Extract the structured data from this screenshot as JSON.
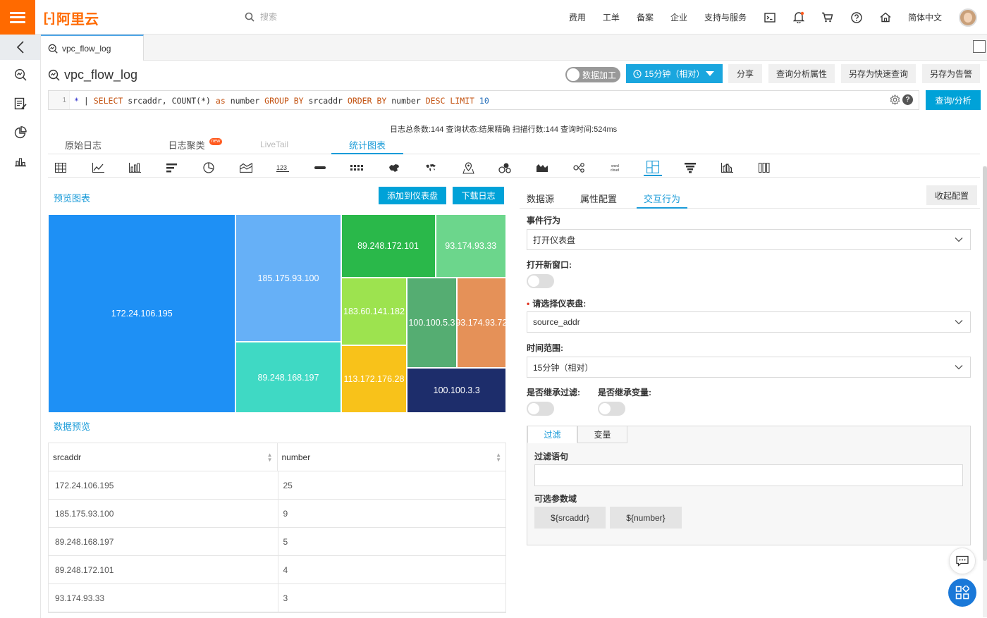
{
  "topbar": {
    "logo_text": "阿里云",
    "search_placeholder": "搜索",
    "nav": [
      "费用",
      "工单",
      "备案",
      "企业",
      "支持与服务"
    ],
    "language": "简体中文",
    "icons": [
      "terminal-icon",
      "bell-icon",
      "cart-icon",
      "help-icon",
      "home-icon"
    ]
  },
  "sidebar": {
    "icons": [
      "back-arrow-icon",
      "search-analysis-icon",
      "edit-list-icon",
      "pie-clock-icon",
      "dashboard-icon"
    ]
  },
  "tabstrip": {
    "active_tab": "vpc_flow_log"
  },
  "logstore": {
    "title": "vpc_flow_log",
    "data_process_label": "数据加工",
    "time_range_label": "15分钟（相对）",
    "buttons": [
      "分享",
      "查询分析属性",
      "另存为快速查询",
      "另存为告警"
    ]
  },
  "query": {
    "line_number": "1",
    "star": "*",
    "pipe": "|",
    "select_kw": "SELECT",
    "field1": "srcaddr,",
    "func": "COUNT(*)",
    "as_kw": "as",
    "alias": "number",
    "groupby_kw": "GROUP BY",
    "group_field": "srcaddr",
    "orderby_kw": "ORDER BY",
    "order_field": "number",
    "desc_kw": "DESC",
    "limit_kw": "LIMIT",
    "limit_val": "10",
    "submit_label": "查询/分析"
  },
  "stats": "日志总条数:144  查询状态:结果精确  扫描行数:144  查询时间:524ms",
  "main_tabs": {
    "raw": "原始日志",
    "cluster": "日志聚类",
    "cluster_badge": "new",
    "livetail": "LiveTail",
    "chart": "统计图表"
  },
  "chart_types": [
    "table",
    "line",
    "column",
    "bar",
    "pie",
    "area",
    "number",
    "progress",
    "flow",
    "map-china",
    "map-world",
    "map-amap",
    "sankey",
    "heatmap",
    "tree",
    "word-cloud",
    "treemap",
    "funnel",
    "histogram",
    "cross-table"
  ],
  "chart_types_active": "treemap",
  "preview": {
    "label": "预览图表",
    "add_to_dashboard": "添加到仪表盘",
    "download_log": "下载日志"
  },
  "chart_data": {
    "type": "treemap",
    "items": [
      {
        "label": "172.24.106.195",
        "value": 25,
        "color": "#1e90f5"
      },
      {
        "label": "185.175.93.100",
        "value": 9,
        "color": "#66b0f7"
      },
      {
        "label": "89.248.168.197",
        "value": 5,
        "color": "#3fd9c4"
      },
      {
        "label": "89.248.172.101",
        "value": 4,
        "color": "#2ab84a"
      },
      {
        "label": "93.174.93.33",
        "value": 3,
        "color": "#6cd68c"
      },
      {
        "label": "183.60.141.182",
        "value": 3,
        "color": "#9de34f"
      },
      {
        "label": "113.172.176.28",
        "value": 3,
        "color": "#f8c21a"
      },
      {
        "label": "100.100.5.3",
        "value": 3,
        "color": "#55ad72"
      },
      {
        "label": "93.174.93.72",
        "value": 3,
        "color": "#e59158"
      },
      {
        "label": "100.100.3.3",
        "value": 3,
        "color": "#1d2d6b"
      }
    ]
  },
  "data_preview": {
    "label": "数据预览",
    "columns": [
      "srcaddr",
      "number"
    ],
    "rows": [
      [
        "172.24.106.195",
        "25"
      ],
      [
        "185.175.93.100",
        "9"
      ],
      [
        "89.248.168.197",
        "5"
      ],
      [
        "89.248.172.101",
        "4"
      ],
      [
        "93.174.93.33",
        "3"
      ]
    ]
  },
  "config": {
    "tabs": [
      "数据源",
      "属性配置",
      "交互行为"
    ],
    "active_tab": "交互行为",
    "collapse_label": "收起配置",
    "event_label": "事件行为",
    "event_value": "打开仪表盘",
    "new_window_label": "打开新窗口:",
    "dashboard_label": "请选择仪表盘:",
    "dashboard_value": "source_addr",
    "time_label": "时间范围:",
    "time_value": "15分钟（相对）",
    "inherit_filter_label": "是否继承过滤:",
    "inherit_var_label": "是否继承变量:",
    "filter_tabs": [
      "过滤",
      "变量"
    ],
    "filter_stmt_label": "过滤语句",
    "params_label": "可选参数域",
    "params": [
      "${srcaddr}",
      "${number}"
    ]
  }
}
